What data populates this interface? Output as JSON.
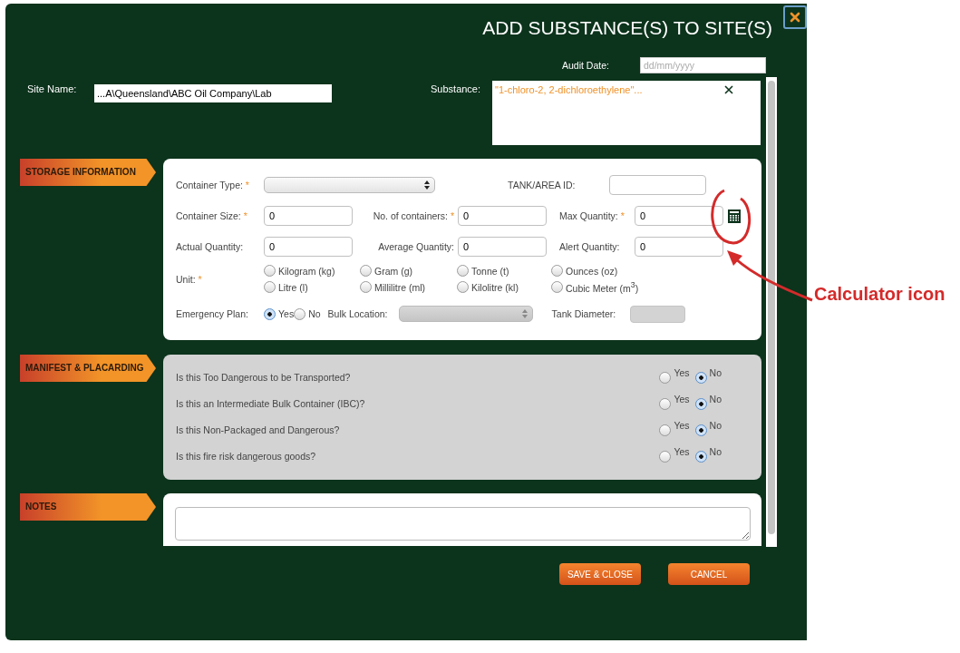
{
  "dialog": {
    "title": "ADD SUBSTANCE(S) TO SITE(S)"
  },
  "audit_date": {
    "label": "Audit Date:",
    "placeholder": "dd/mm/yyyy"
  },
  "site_name": {
    "label": "Site Name:",
    "value": "...A\\Queensland\\ABC Oil Company\\Lab"
  },
  "substance": {
    "label": "Substance:",
    "items": [
      {
        "name": "\"1-chloro-2, 2-dichloroethylene\"..."
      }
    ]
  },
  "storage": {
    "heading": "STORAGE INFORMATION",
    "rows": [
      [
        {
          "kind": "select",
          "label": "Container Type:",
          "marker": "*"
        },
        {
          "kind": "text",
          "label": "TANK/AREA ID:"
        }
      ],
      [
        {
          "kind": "text",
          "label": "Container Size:",
          "marker": "*",
          "value": "0"
        },
        {
          "kind": "text",
          "label": "No. of containers:",
          "marker": "*",
          "value": "0"
        },
        {
          "kind": "calc",
          "label": "Max Quantity:",
          "marker": "*",
          "value": "0"
        }
      ],
      [
        {
          "kind": "text",
          "label": "Actual Quantity:",
          "value": "0"
        },
        {
          "kind": "text",
          "label": "Average Quantity:",
          "value": "0"
        },
        {
          "kind": "text",
          "label": "Alert Quantity:",
          "value": "0"
        }
      ]
    ],
    "unit": {
      "label": "Unit:",
      "marker": "*",
      "options": [
        {
          "label": "Kilogram (kg)",
          "selected": false
        },
        {
          "label": "Gram (g)",
          "selected": false
        },
        {
          "label": "Tonne (t)",
          "selected": false
        },
        {
          "label": "Ounces (oz)",
          "selected": false
        },
        {
          "label": "Litre (l)",
          "selected": false
        },
        {
          "label": "Millilitre (ml)",
          "selected": false
        },
        {
          "label": "Kilolitre (kl)",
          "selected": false
        },
        {
          "label": "Cubic Meter (m$^{3}$)",
          "selected": false
        }
      ]
    },
    "emergency_plan": {
      "label": "Emergency Plan:",
      "options": [
        {
          "label": "Yes",
          "selected": true
        },
        {
          "label": "No",
          "selected": false
        }
      ]
    },
    "bulk_location": {
      "label": "Bulk Location:",
      "disabled": true
    },
    "tank_diameter": {
      "label": "Tank Diameter:",
      "disabled": true
    }
  },
  "manifest": {
    "heading": "MANIFEST & PLACARDING",
    "questions": [
      {
        "text": "Is this Too Dangerous to be Transported?",
        "options": [
          {
            "label": "Yes",
            "selected": false
          },
          {
            "label": "No",
            "selected": true
          }
        ]
      },
      {
        "text": "Is this an Intermediate Bulk Container (IBC)?",
        "options": [
          {
            "label": "Yes",
            "selected": false
          },
          {
            "label": "No",
            "selected": true
          }
        ]
      },
      {
        "text": "Is this Non-Packaged and Dangerous?",
        "options": [
          {
            "label": "Yes",
            "selected": false
          },
          {
            "label": "No",
            "selected": true
          }
        ]
      },
      {
        "text": "Is this fire risk dangerous goods?",
        "options": [
          {
            "label": "Yes",
            "selected": false
          },
          {
            "label": "No",
            "selected": true
          }
        ]
      }
    ]
  },
  "notes": {
    "heading": "NOTES"
  },
  "buttons": [
    "SAVE & CLOSE",
    "CANCEL"
  ],
  "annotation": {
    "text": "Calculator icon"
  }
}
